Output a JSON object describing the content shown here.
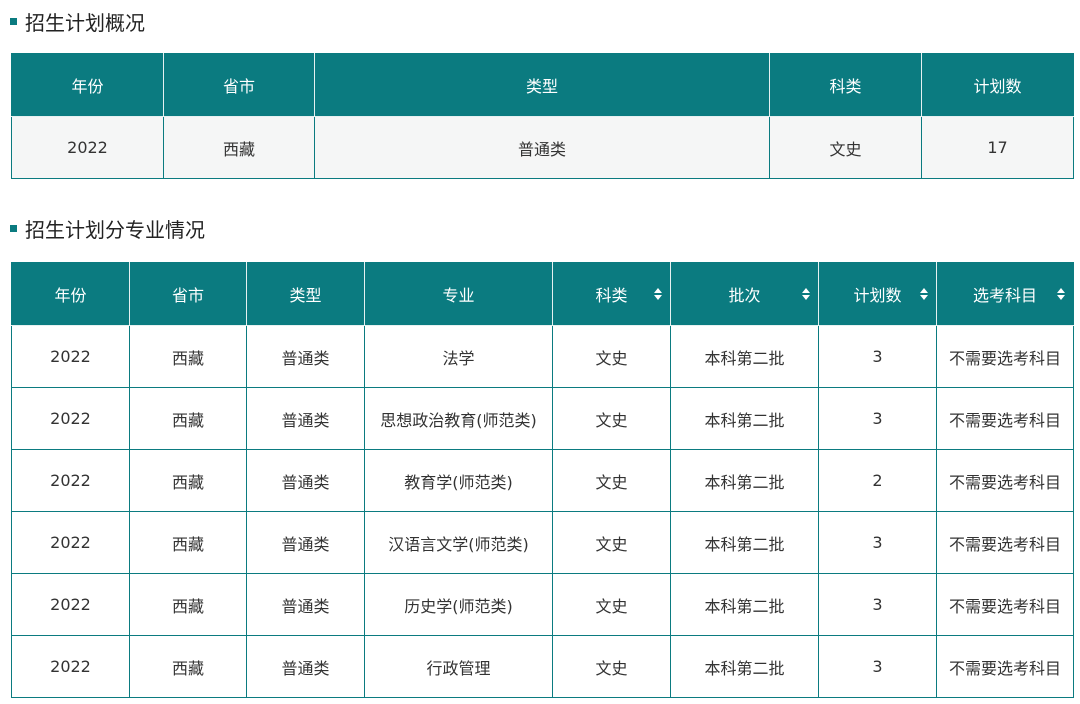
{
  "colors": {
    "accent": "#0b7b80"
  },
  "overview": {
    "title": "招生计划概况",
    "headers": [
      "年份",
      "省市",
      "类型",
      "科类",
      "计划数"
    ],
    "rows": [
      [
        "2022",
        "西藏",
        "普通类",
        "文史",
        "17"
      ]
    ]
  },
  "majors": {
    "title": "招生计划分专业情况",
    "headers": [
      "年份",
      "省市",
      "类型",
      "专业",
      "科类",
      "批次",
      "计划数",
      "选考科目"
    ],
    "sortable": [
      false,
      false,
      false,
      false,
      true,
      true,
      true,
      true
    ],
    "rows": [
      [
        "2022",
        "西藏",
        "普通类",
        "法学",
        "文史",
        "本科第二批",
        "3",
        "不需要选考科目"
      ],
      [
        "2022",
        "西藏",
        "普通类",
        "思想政治教育(师范类)",
        "文史",
        "本科第二批",
        "3",
        "不需要选考科目"
      ],
      [
        "2022",
        "西藏",
        "普通类",
        "教育学(师范类)",
        "文史",
        "本科第二批",
        "2",
        "不需要选考科目"
      ],
      [
        "2022",
        "西藏",
        "普通类",
        "汉语言文学(师范类)",
        "文史",
        "本科第二批",
        "3",
        "不需要选考科目"
      ],
      [
        "2022",
        "西藏",
        "普通类",
        "历史学(师范类)",
        "文史",
        "本科第二批",
        "3",
        "不需要选考科目"
      ],
      [
        "2022",
        "西藏",
        "普通类",
        "行政管理",
        "文史",
        "本科第二批",
        "3",
        "不需要选考科目"
      ]
    ]
  }
}
